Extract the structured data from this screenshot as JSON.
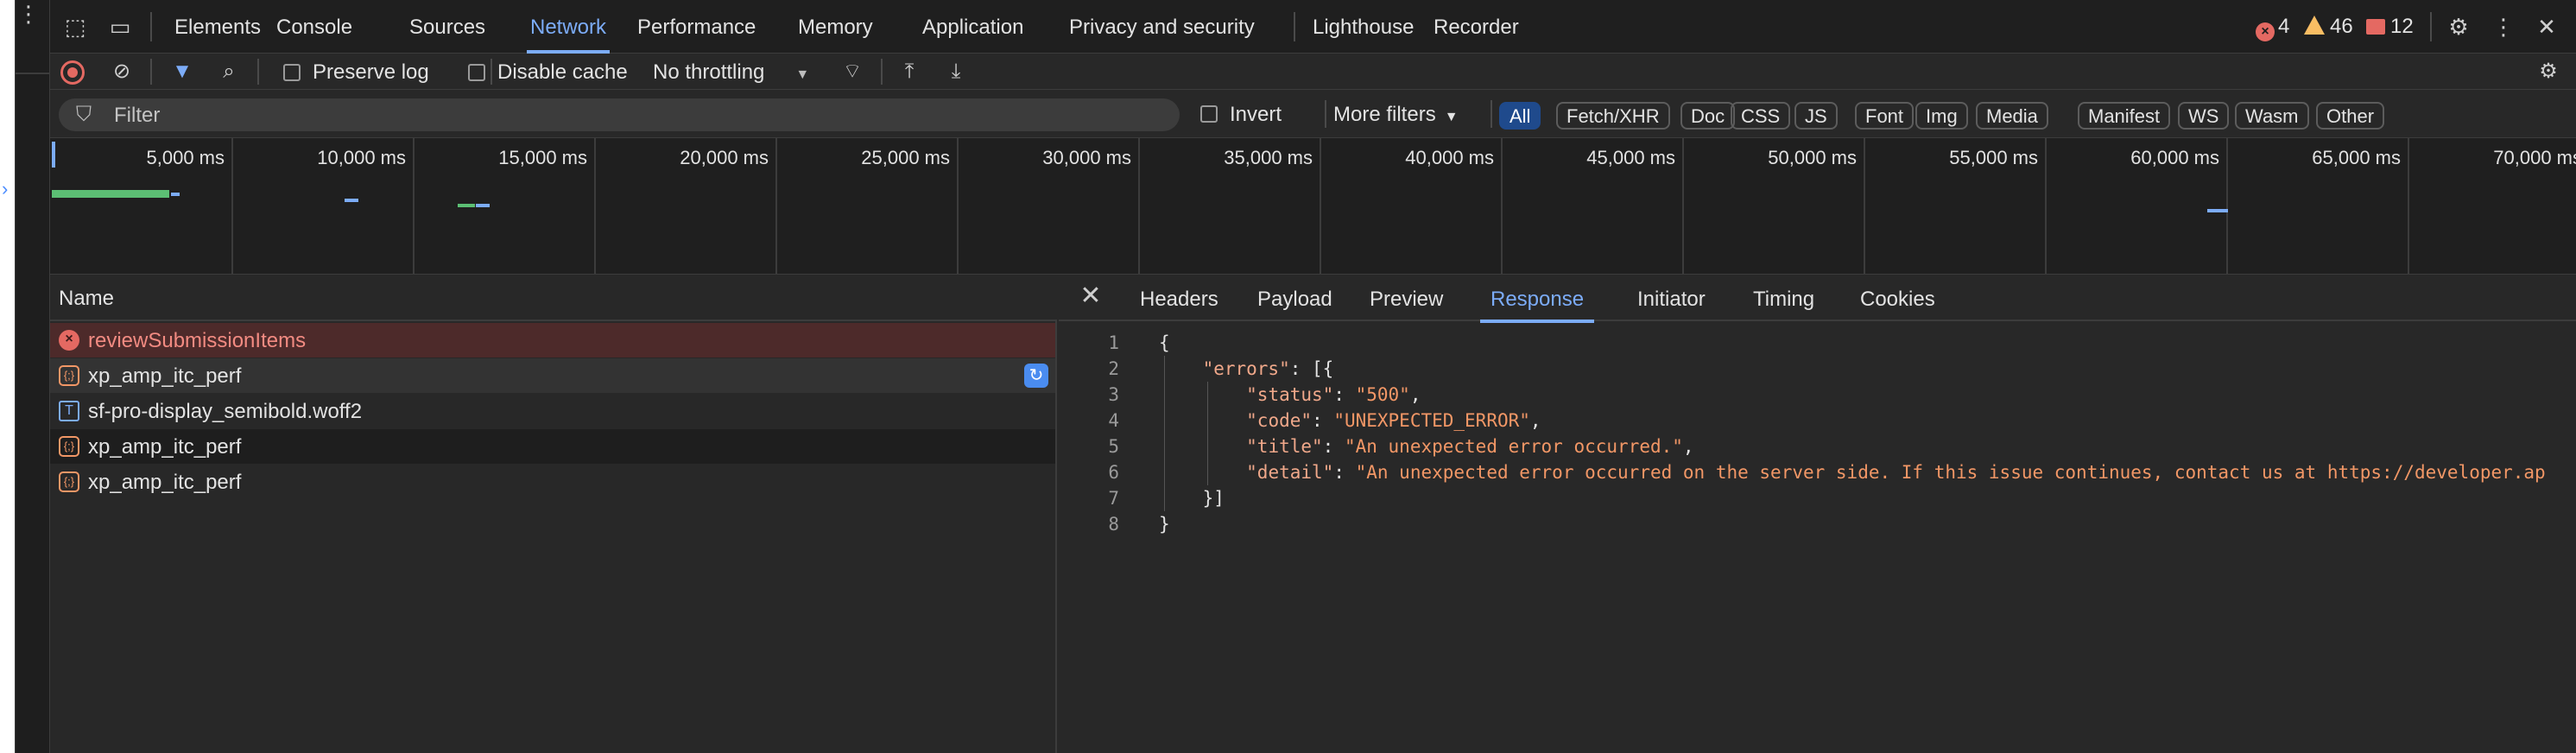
{
  "devtools": {
    "tabs": [
      "Elements",
      "Console",
      "Sources",
      "Network",
      "Performance",
      "Memory",
      "Application",
      "Privacy and security",
      "Lighthouse",
      "Recorder"
    ],
    "active_tab": "Network",
    "counts": {
      "errors": "4",
      "warnings": "46",
      "messages": "12"
    }
  },
  "toolbar": {
    "preserve_log": "Preserve log",
    "disable_cache": "Disable cache",
    "throttling": "No throttling"
  },
  "filter": {
    "placeholder": "Filter",
    "invert": "Invert",
    "more_filters": "More filters",
    "types": [
      "All",
      "Fetch/XHR",
      "Doc",
      "CSS",
      "JS",
      "Font",
      "Img",
      "Media",
      "Manifest",
      "WS",
      "Wasm",
      "Other"
    ],
    "active_type": "All"
  },
  "overview": {
    "ticks": [
      "5,000 ms",
      "10,000 ms",
      "15,000 ms",
      "20,000 ms",
      "25,000 ms",
      "30,000 ms",
      "35,000 ms",
      "40,000 ms",
      "45,000 ms",
      "50,000 ms",
      "55,000 ms",
      "60,000 ms",
      "65,000 ms",
      "70,000 ms"
    ]
  },
  "requests": {
    "header": "Name",
    "rows": [
      {
        "name": "reviewSubmissionItems",
        "type": "error",
        "icon": "error-icon"
      },
      {
        "name": "xp_amp_itc_perf",
        "type": "json",
        "icon": "json-icon"
      },
      {
        "name": "sf-pro-display_semibold.woff2",
        "type": "font",
        "icon": "font-icon"
      },
      {
        "name": "xp_amp_itc_perf",
        "type": "json",
        "icon": "json-icon"
      },
      {
        "name": "xp_amp_itc_perf",
        "type": "json",
        "icon": "json-icon"
      }
    ]
  },
  "details": {
    "tabs": [
      "Headers",
      "Payload",
      "Preview",
      "Response",
      "Initiator",
      "Timing",
      "Cookies"
    ],
    "active_tab": "Response",
    "response_lines": [
      {
        "n": "1",
        "parts": [
          [
            "p",
            "{"
          ]
        ]
      },
      {
        "n": "2",
        "parts": [
          [
            "p",
            "    "
          ],
          [
            "k",
            "\"errors\""
          ],
          [
            "p",
            ": [{"
          ]
        ]
      },
      {
        "n": "3",
        "parts": [
          [
            "p",
            "        "
          ],
          [
            "k",
            "\"status\""
          ],
          [
            "p",
            ": "
          ],
          [
            "s",
            "\"500\""
          ],
          [
            "p",
            ","
          ]
        ]
      },
      {
        "n": "4",
        "parts": [
          [
            "p",
            "        "
          ],
          [
            "k",
            "\"code\""
          ],
          [
            "p",
            ": "
          ],
          [
            "s",
            "\"UNEXPECTED_ERROR\""
          ],
          [
            "p",
            ","
          ]
        ]
      },
      {
        "n": "5",
        "parts": [
          [
            "p",
            "        "
          ],
          [
            "k",
            "\"title\""
          ],
          [
            "p",
            ": "
          ],
          [
            "s",
            "\"An unexpected error occurred.\""
          ],
          [
            "p",
            ","
          ]
        ]
      },
      {
        "n": "6",
        "parts": [
          [
            "p",
            "        "
          ],
          [
            "k",
            "\"detail\""
          ],
          [
            "p",
            ": "
          ],
          [
            "s",
            "\"An unexpected error occurred on the server side. If this issue continues, contact us at https://developer.ap"
          ]
        ]
      },
      {
        "n": "7",
        "parts": [
          [
            "p",
            "    }]"
          ]
        ]
      },
      {
        "n": "8",
        "parts": [
          [
            "p",
            "}"
          ]
        ]
      }
    ]
  },
  "colors": {
    "accent": "#7cacf8",
    "error": "#e46962",
    "warning": "#f9bd63",
    "json_key": "#f0a88a",
    "json_string": "#f29766"
  }
}
